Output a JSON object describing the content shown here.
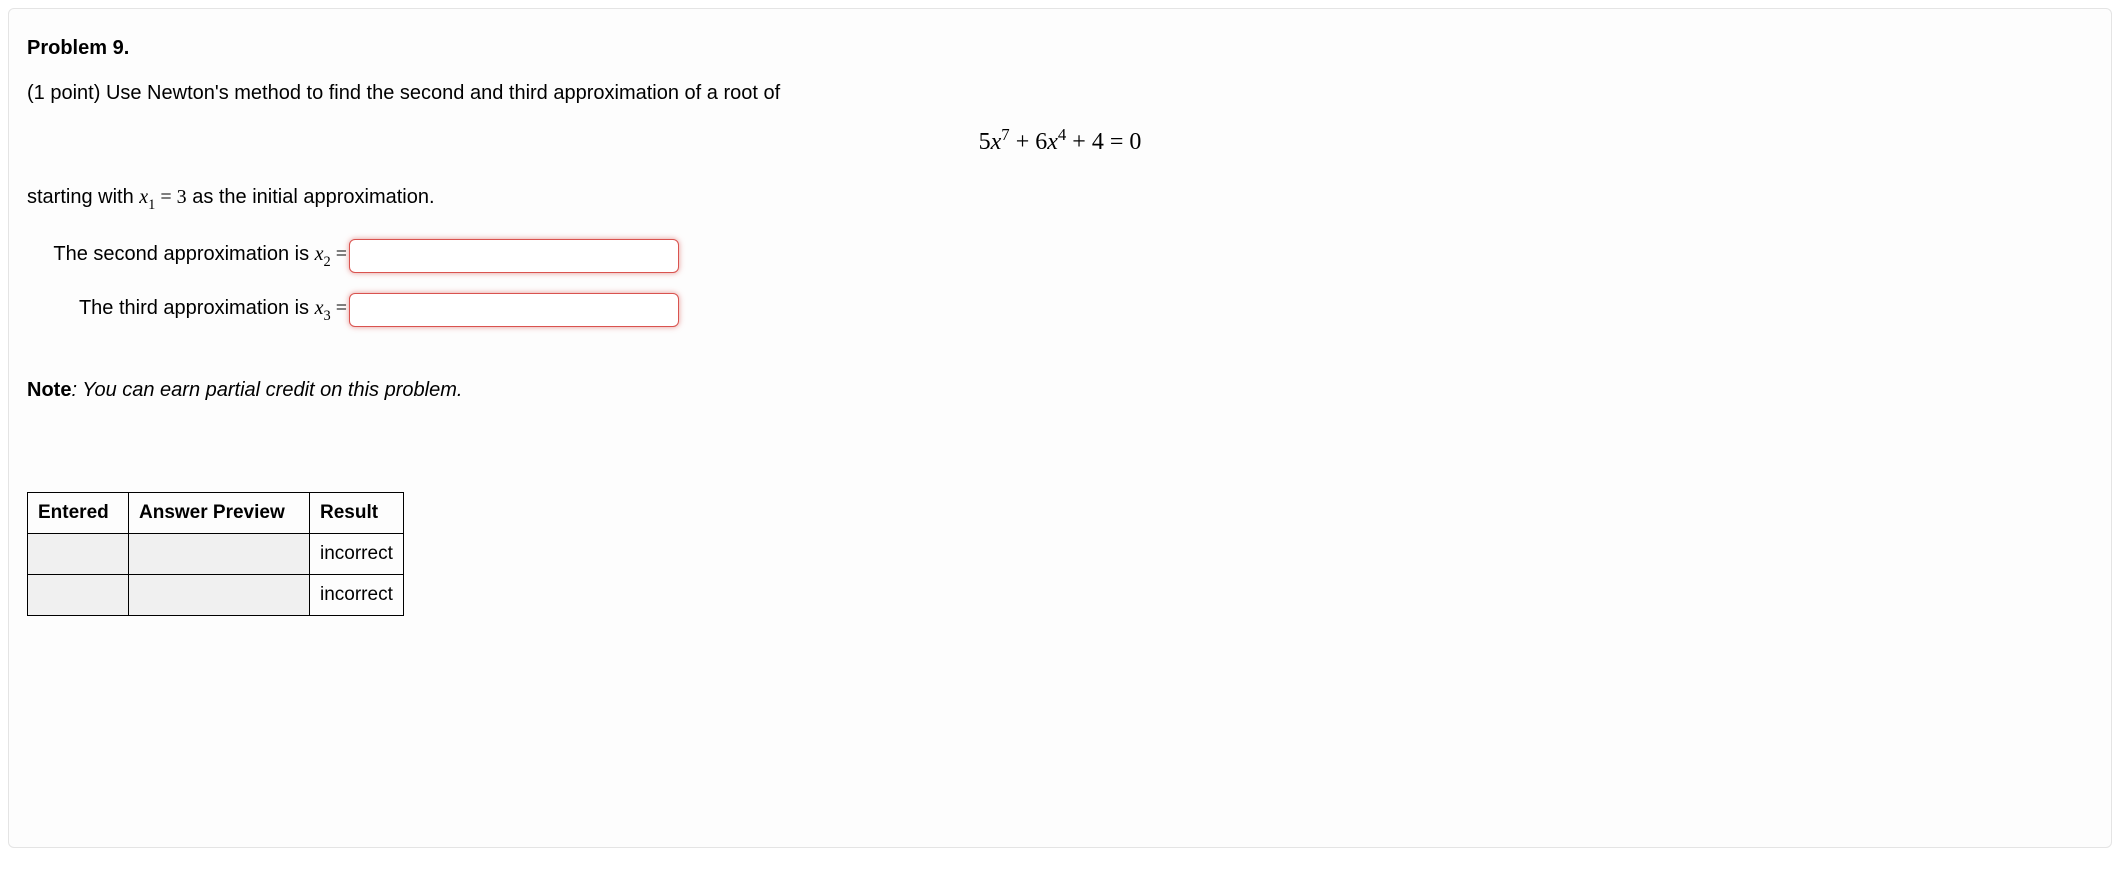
{
  "problem": {
    "title": "Problem 9.",
    "points_prefix": "(1 point) ",
    "prompt": "Use Newton's method to find the second and third approximation of a root of",
    "equation_html": "5<span class=\"math\">x</span><sup>7</sup> + 6<span class=\"math\">x</span><sup>4</sup> + 4 = 0",
    "starting_prefix": "starting with ",
    "starting_var": "x",
    "starting_sub": "1",
    "starting_mid": " = 3",
    "starting_suffix": " as the initial approximation."
  },
  "answers": {
    "row1": {
      "label_prefix": "The second approximation is ",
      "var": "x",
      "sub": "2",
      "eq": " =",
      "value": ""
    },
    "row2": {
      "label_prefix": "The third approximation is ",
      "var": "x",
      "sub": "3",
      "eq": " =",
      "value": ""
    }
  },
  "note": {
    "label": "Note",
    "text": ": You can earn partial credit on this problem."
  },
  "results": {
    "headers": {
      "entered": "Entered",
      "preview": "Answer Preview",
      "result": "Result"
    },
    "rows": [
      {
        "entered": "",
        "preview": "",
        "result": "incorrect"
      },
      {
        "entered": "",
        "preview": "",
        "result": "incorrect"
      }
    ]
  }
}
